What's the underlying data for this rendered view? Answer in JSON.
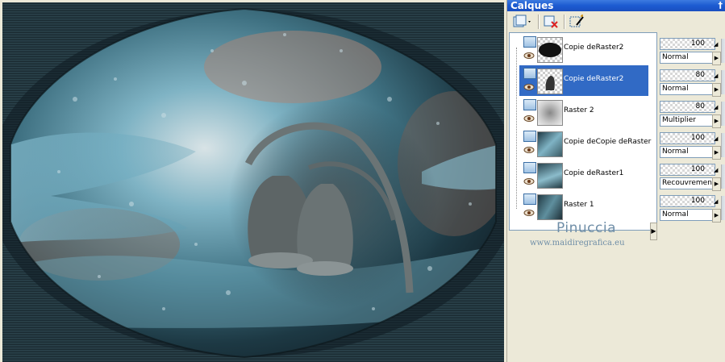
{
  "panel": {
    "title": "Calques",
    "pin_glyph": "†"
  },
  "toolbar": {
    "icons": [
      "new-layer-icon",
      "delete-layer-icon",
      "edit-layer-icon"
    ]
  },
  "layers": [
    {
      "name": "Copie deRaster2",
      "selected": false,
      "opacity": "100",
      "blend": "Normal"
    },
    {
      "name": "Copie deRaster2",
      "selected": true,
      "opacity": "80",
      "blend": "Normal"
    },
    {
      "name": "Raster 2",
      "selected": false,
      "opacity": "80",
      "blend": "Multiplier"
    },
    {
      "name": "Copie deCopie deRaster",
      "selected": false,
      "opacity": "100",
      "blend": "Normal"
    },
    {
      "name": "Copie deRaster1",
      "selected": false,
      "opacity": "100",
      "blend": "Recouvrement"
    },
    {
      "name": "Raster 1",
      "selected": false,
      "opacity": "100",
      "blend": "Normal"
    }
  ],
  "signature": {
    "title": "Pinuccia",
    "url": "www.maidiregrafica.eu"
  },
  "colors": {
    "selection": "#316ac5",
    "title_bar": "#1c5bd1",
    "canvas_dark": "#1b2c33",
    "accent_teal": "#6fa9bb"
  }
}
